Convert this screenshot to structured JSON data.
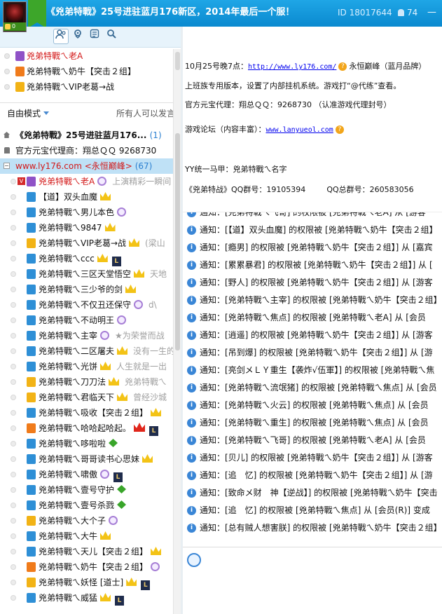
{
  "header": {
    "title": "《兇弟特戰》25号进驻蓝月176新区，2014年最后一个服！",
    "id_text": "ID 18017644",
    "online_count": "74",
    "avatar_count": "0",
    "minimize": "—"
  },
  "pinned": [
    {
      "name": "兇弟特戰ㄟ老A",
      "color": "#d31818",
      "icon": "p"
    },
    {
      "name": "兇弟特戰ㄟ奶牛【突击２组】",
      "color": "#111",
      "icon": "o"
    },
    {
      "name": "兇弟特戰ㄟVIP老葛→战",
      "color": "#111",
      "icon": "y"
    }
  ],
  "mode": {
    "label": "自由模式",
    "speak": "所有人可以发言"
  },
  "channels": [
    {
      "name": "《兇弟特戰》25号进驻蓝月176...",
      "count": "(1)"
    },
    {
      "name": "官方元宝代理商：翔总ＱＱ 9268730",
      "count": ""
    },
    {
      "name": "www.ly176.com <永恒巅峰>",
      "count": "(67)"
    }
  ],
  "users": [
    {
      "name": "兇弟特戰ㄟ老A",
      "sig": "上演精彩一瞬间",
      "red": true,
      "icon": "p"
    },
    {
      "name": "【道】双头血魔",
      "sig": "",
      "icon": "b"
    },
    {
      "name": "兇弟特戰ㄟ男儿本色",
      "sig": "",
      "icon": "b"
    },
    {
      "name": "兇弟特戰ㄟ9847",
      "sig": "",
      "icon": "b"
    },
    {
      "name": "兇弟特戰ㄟVIP老葛→战",
      "sig": "(梁山",
      "icon": "y"
    },
    {
      "name": "兇弟特戰ㄟccc",
      "sig": "",
      "icon": "b"
    },
    {
      "name": "兇弟特戰ㄟ三区天堂悟空",
      "sig": "天地",
      "icon": "b"
    },
    {
      "name": "兇弟特戰ㄟ三少爷的剑",
      "sig": "",
      "icon": "b"
    },
    {
      "name": "兇弟特戰ㄟ不仅丑还保守",
      "sig": "d\\",
      "icon": "b"
    },
    {
      "name": "兇弟特戰ㄟ不动明王",
      "sig": "",
      "icon": "b"
    },
    {
      "name": "兇弟特戰ㄟ主宰",
      "sig": "★为荣誉而战",
      "icon": "b"
    },
    {
      "name": "兇弟特戰ㄟ二区屠夫",
      "sig": "没有一生的",
      "icon": "b"
    },
    {
      "name": "兇弟特戰ㄟ光饼",
      "sig": "人生就是一出",
      "icon": "b"
    },
    {
      "name": "兇弟特戰ㄟ刀刀法",
      "sig": "兇弟特戰ㄟ",
      "icon": "y"
    },
    {
      "name": "兇弟特戰ㄟ君临天下",
      "sig": "曾经沙城",
      "icon": "y"
    },
    {
      "name": "兇弟特戰ㄟ吸收【突击２组】",
      "sig": "",
      "icon": "b"
    },
    {
      "name": "兇弟特戰ㄟ哈哈起哈起。",
      "sig": "",
      "icon": "o"
    },
    {
      "name": "兇弟特戰ㄟ哆啦啦",
      "sig": "",
      "icon": "b"
    },
    {
      "name": "兇弟特戰ㄟ哥哥读书心思妹",
      "sig": "",
      "icon": "b"
    },
    {
      "name": "兇弟特戰ㄟ啸傲",
      "sig": "",
      "icon": "b"
    },
    {
      "name": "兇弟特戰ㄟ壹号守护",
      "sig": "",
      "icon": "b"
    },
    {
      "name": "兇弟特戰ㄟ壹号杀戮",
      "sig": "",
      "icon": "b"
    },
    {
      "name": "兇弟特戰ㄟ大个子",
      "sig": "",
      "icon": "y"
    },
    {
      "name": "兇弟特戰ㄟ大牛",
      "sig": "",
      "icon": "b"
    },
    {
      "name": "兇弟特戰ㄟ天儿【突击２组】",
      "sig": "",
      "icon": "b"
    },
    {
      "name": "兇弟特戰ㄟ奶牛【突击２组】",
      "sig": "",
      "icon": "o"
    },
    {
      "name": "兇弟特戰ㄟ妖怪 [道士]",
      "sig": "",
      "icon": "y"
    },
    {
      "name": "兇弟特戰ㄟ威猛",
      "sig": "",
      "icon": "b"
    }
  ],
  "announce": {
    "line1_pre": "10月25号晚7点：",
    "line1_link": "http://www.ly176.com/",
    "line1_post": "永恒巅峰（蓝月品牌）",
    "line2": "上班族专用版本，设置了内部挂机系统。游戏打“@代练”查看。",
    "line3": "官方元宝代理：翔总ＱＱ：9268730 （认准游戏代理封号）",
    "line4_pre": "游戏论坛（内容丰富）：",
    "line4_link": "www.lanyueol.com",
    "line5": "YY统一马甲：兇弟特戰ㄟ名字",
    "line6a": "《兇弟特战》QQ群号：19105394",
    "line6b": "QQ总群号：260583056"
  },
  "notices": [
    "通知：[兇弟特戰ㄟ飞哥] 的权限被 [兇弟特戰ㄟ老A] 从 [游客",
    "通知：[【道】双头血魔] 的权限被 [兇弟特戰ㄟ奶牛【突击２组】",
    "通知：[瘾男] 的权限被 [兇弟特戰ㄟ奶牛【突击２组】] 从 [嘉宾",
    "通知：[累累暴君] 的权限被 [兇弟特戰ㄟ奶牛【突击２组】] 从 [",
    "通知：[野人] 的权限被 [兇弟特戰ㄟ奶牛【突击２组】] 从 [游客",
    "通知：[兇弟特戰ㄟ主宰] 的权限被 [兇弟特戰ㄟ奶牛【突击２组】",
    "通知：[兇弟特戰ㄟ焦点] 的权限被 [兇弟特戰ㄟ老A] 从 [会员",
    "通知：[逍遥] 的权限被 [兇弟特戰ㄟ奶牛【突击２组】] 从 [游客",
    "通知：[吊到爆] 的权限被 [兇弟特戰ㄟ奶牛【突击２组】] 从 [游",
    "通知：[亮剑メＬＹ重生【袭炸√伍軍】] 的权限被 [兇弟特戰ㄟ焦",
    "通知：[兇弟特戰ㄟ流氓猪] 的权限被 [兇弟特戰ㄟ焦点] 从 [会员",
    "通知：[兇弟特戰ㄟ火云] 的权限被 [兇弟特戰ㄟ焦点] 从 [会员",
    "通知：[兇弟特戰ㄟ重生] 的权限被 [兇弟特戰ㄟ焦点] 从 [会员",
    "通知：[兇弟特戰ㄟ飞哥] 的权限被 [兇弟特戰ㄟ老A] 从 [会员",
    "通知：[贝儿] 的权限被 [兇弟特戰ㄟ奶牛【突击２组】] 从 [游客",
    "通知：[追　忆] 的权限被 [兇弟特戰ㄟ奶牛【突击２组】] 从 [游",
    "通知：[致命メ财　神【逆战】] 的权限被 [兇弟特戰ㄟ奶牛【突击",
    "通知：[追　忆] 的权限被 [兇弟特戰ㄟ焦点] 从 [会员(R)] 变成",
    "通知：[总有贼人想害朕] 的权限被 [兇弟特戰ㄟ奶牛【突击２组】"
  ]
}
